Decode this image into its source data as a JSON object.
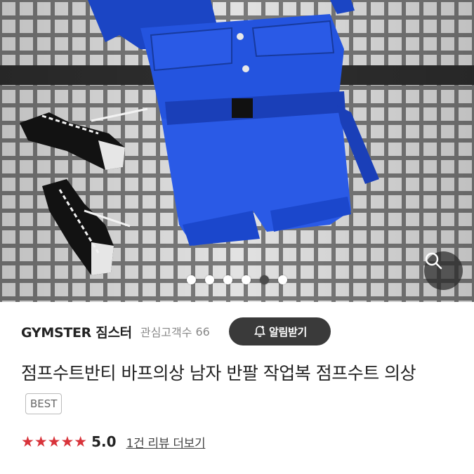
{
  "gallery": {
    "image_description": "Blue short-sleeve romper on metal grid with black high-top sneakers",
    "dots": [
      false,
      false,
      false,
      false,
      true,
      false
    ],
    "zoom_icon": "search-icon"
  },
  "store": {
    "name": "GYMSTER 짐스터",
    "fav_label": "관심고객수",
    "fav_count": "66",
    "alert_label": "알림받기",
    "alert_icon": "bell-plus-icon"
  },
  "product": {
    "title": "점프수트반티 바프의상 남자 반팔 작업복 점프수트 의상",
    "badge": "BEST"
  },
  "rating": {
    "stars": "★★★★★",
    "score": "5.0",
    "review_link": "1건 리뷰 더보기"
  },
  "price_partial": "",
  "colors": {
    "accent_star": "#d8333a",
    "button_bg": "#3a3a3a",
    "romper": "#1f4fd6"
  }
}
